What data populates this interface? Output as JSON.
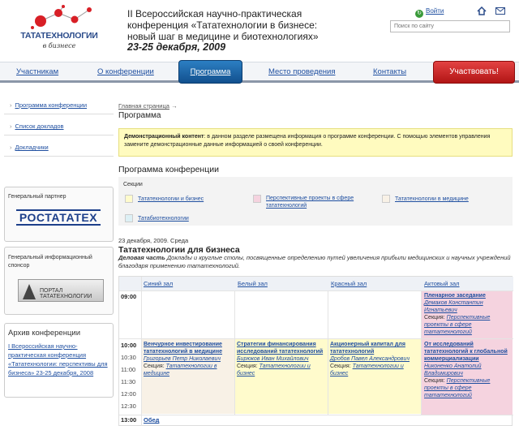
{
  "brand": {
    "logo_text": "ТАТАТЕХНОЛОГИИ",
    "logo_sub": "в бизнесе"
  },
  "header": {
    "conference_title": "II Всероссийская научно-практическая конференция «Тататехнологии в бизнесе: новый шаг в медицине и биотехнологиях»",
    "conference_date": "23-25 декабря, 2009",
    "login_label": "Войти",
    "search_placeholder": "Поиск по сайту"
  },
  "nav": {
    "items": [
      "Участникам",
      "О конференции",
      "Программа",
      "Место проведения",
      "Контакты"
    ],
    "active": "Программа",
    "register_label": "Участвовать!"
  },
  "sidebar": {
    "links": [
      "Программа конференции",
      "Список докладов",
      "Докладчики"
    ],
    "general_partner_label": "Генеральный партнер",
    "general_partner_logo": "РОСТАТАТЕХ",
    "info_sponsor_label": "Генеральный информационный спонсор",
    "info_sponsor_logo": "ПОРТАЛ ТАТАТЕХНОЛОГИИ",
    "archive_title": "Архив конференции",
    "archive_text": "I Всероссийская научно-практическая конференция «Тататехнологии: перспективы для бизнеса» 23-25 декабря, 2008"
  },
  "main": {
    "breadcrumb_home": "Главная страница",
    "breadcrumb_arrow": "→",
    "page_title": "Программа",
    "demo_bold": "Демонстрационный контент",
    "demo_text": ": в данном разделе размещена информация о программе конференции. С помощью элементов управления замените демонстрационные данные информацией о своей конференции.",
    "program_title": "Программа конференции",
    "sections_label": "Секции",
    "sections": [
      {
        "name": "Тататехнологии и бизнес",
        "color": "#fffbcc"
      },
      {
        "name": "Перспективные проекты в сфере тататехнологий",
        "color": "#f5d3df"
      },
      {
        "name": "Тататехнологии в медицине",
        "color": "#f8f1e6"
      },
      {
        "name": "Татабиотехнологии",
        "color": "#ddf0f5"
      }
    ],
    "day_date": "23 декабря, 2009. Среда",
    "day_title": "Тататехнологии для бизнеса",
    "day_desc_bold": "Деловая часть",
    "day_desc": " Доклады и круглые столы, посвященные определению путей увеличения прибыли медицинских и научных учреждений благодаря применению тататехнологий."
  },
  "schedule": {
    "halls": [
      "Синий зал",
      "Белый зал",
      "Красный зал",
      "Актовый зал"
    ],
    "times": [
      "09:00",
      "10:00",
      "10:30",
      "11:00",
      "11:30",
      "12:00",
      "12:30",
      "13:00"
    ],
    "plenary": {
      "title": "Пленарное заседание",
      "person": "Демаков Константин Игнатьевич",
      "section_prefix": "Секция:",
      "section": "Перспективные проекты в сфере тататехнологий"
    },
    "sessions": [
      {
        "title": "Венчурное инвестирование тататехнологий в медицине",
        "person": "Григорьев Петр Николаевич",
        "section_prefix": "Секция:",
        "section": "Тататехнологии в медицине"
      },
      {
        "title": "Стратегии финансирования исследований тататехнологий",
        "person": "Бирюков Иван Михайлович",
        "section_prefix": "Секция:",
        "section": "Тататехнологии и бизнес"
      },
      {
        "title": "Акционерный капитал для тататехнологий",
        "person": "Дробов Павел Александрович",
        "section_prefix": "Секция:",
        "section": "Тататехнологии и бизнес"
      },
      {
        "title": "От исследований тататехнологий к глобальной коммерциализации",
        "person": "Никоненко Анатолий Владимирович",
        "section_prefix": "Секция:",
        "section": "Перспективные проекты в сфере тататехнологий"
      }
    ],
    "lunch_label": "Обед"
  },
  "colors": {
    "brand_blue": "#1f4fa0",
    "nav_active": "#12508e",
    "register_red": "#c41f1f",
    "yellow_session": "#fffbcc",
    "pink_session": "#f5d3df",
    "cream_session": "#f8f1e6"
  },
  "icons": [
    "login-icon",
    "home-icon",
    "mail-icon",
    "breadcrumb-arrow-icon"
  ]
}
